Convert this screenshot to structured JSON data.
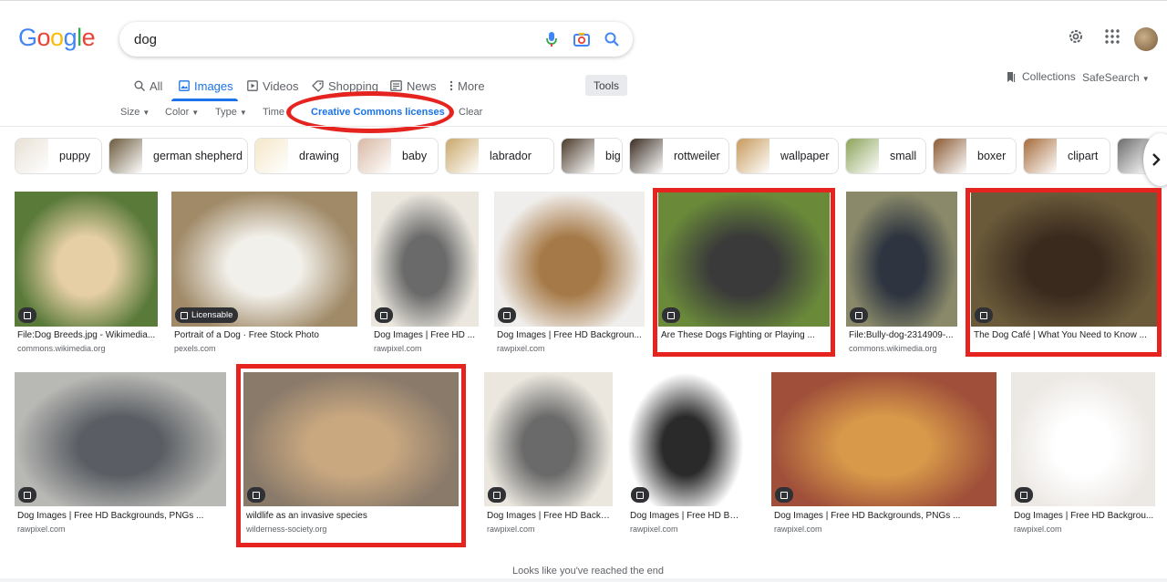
{
  "brand": {
    "letters": [
      {
        "ch": "G",
        "color": "#4285f4"
      },
      {
        "ch": "o",
        "color": "#ea4335"
      },
      {
        "ch": "o",
        "color": "#fbbc05"
      },
      {
        "ch": "g",
        "color": "#4285f4"
      },
      {
        "ch": "l",
        "color": "#34a853"
      },
      {
        "ch": "e",
        "color": "#ea4335"
      }
    ]
  },
  "search": {
    "value": "dog",
    "placeholder": ""
  },
  "header": {
    "settings_icon": "gear-icon",
    "apps_icon": "apps-grid-icon",
    "avatar_icon": "avatar"
  },
  "tabs": [
    {
      "label": "All",
      "icon": "search-icon",
      "active": false
    },
    {
      "label": "Images",
      "icon": "image-icon",
      "active": true
    },
    {
      "label": "Videos",
      "icon": "video-icon",
      "active": false
    },
    {
      "label": "Shopping",
      "icon": "tag-icon",
      "active": false
    },
    {
      "label": "News",
      "icon": "news-icon",
      "active": false
    },
    {
      "label": "More",
      "icon": "kebab-icon",
      "active": false
    }
  ],
  "tools_label": "Tools",
  "collections_label": "Collections",
  "safesearch_label": "SafeSearch",
  "filters": [
    {
      "label": "Size",
      "active": false
    },
    {
      "label": "Color",
      "active": false
    },
    {
      "label": "Type",
      "active": false
    },
    {
      "label": "Time",
      "active": false
    },
    {
      "label": "Creative Commons licenses",
      "active": true
    },
    {
      "label": "Clear",
      "active": false
    }
  ],
  "chips": [
    {
      "label": "puppy",
      "color": "#e8e0d4"
    },
    {
      "label": "german shepherd",
      "color": "#6b5a3c"
    },
    {
      "label": "drawing",
      "color": "#f5e7c8"
    },
    {
      "label": "baby",
      "color": "#d9b8a4"
    },
    {
      "label": "labrador",
      "color": "#c9a86a"
    },
    {
      "label": "big",
      "color": "#4a3a2a"
    },
    {
      "label": "rottweiler",
      "color": "#3a2d22"
    },
    {
      "label": "wallpaper",
      "color": "#c79a5c"
    },
    {
      "label": "small",
      "color": "#8ca35a"
    },
    {
      "label": "boxer",
      "color": "#8a5a32"
    },
    {
      "label": "clipart",
      "color": "#a66b3a"
    },
    {
      "label": "",
      "color": "#6c6c6c"
    }
  ],
  "results": [
    {
      "title": "File:Dog Breeds.jpg - Wikimedia...",
      "source": "commons.wikimedia.org",
      "licensable": false,
      "highlighted": false,
      "colors": [
        "#5a7a3a",
        "#e6cfa5"
      ]
    },
    {
      "title": "Portrait of a Dog · Free Stock Photo",
      "source": "pexels.com",
      "licensable": true,
      "highlighted": false,
      "colors": [
        "#a08a68",
        "#f2f0ea"
      ]
    },
    {
      "title": "Dog Images | Free HD ...",
      "source": "rawpixel.com",
      "licensable": false,
      "highlighted": false,
      "colors": [
        "#ebe7df",
        "#6a6a6a"
      ]
    },
    {
      "title": "Dog Images | Free HD Backgroun...",
      "source": "rawpixel.com",
      "licensable": false,
      "highlighted": false,
      "colors": [
        "#f0eeec",
        "#a67a48"
      ]
    },
    {
      "title": "Are These Dogs Fighting or Playing ...",
      "source": "",
      "licensable": false,
      "highlighted": true,
      "colors": [
        "#6a8a3a",
        "#3a3a3a"
      ]
    },
    {
      "title": "File:Bully-dog-2314909-...",
      "source": "commons.wikimedia.org",
      "licensable": false,
      "highlighted": false,
      "colors": [
        "#8a8a6a",
        "#2e3440"
      ]
    },
    {
      "title": "The Dog Café | What You Need to Know ...",
      "source": "",
      "licensable": false,
      "highlighted": true,
      "colors": [
        "#6a5a3a",
        "#3a2a1e"
      ]
    },
    {
      "title": "Dog Images | Free HD Backgrounds, PNGs ...",
      "source": "rawpixel.com",
      "licensable": false,
      "highlighted": false,
      "colors": [
        "#b8b8b4",
        "#5a5e64"
      ]
    },
    {
      "title": "wildlife as an invasive species",
      "source": "wilderness-society.org",
      "licensable": false,
      "highlighted": true,
      "colors": [
        "#8a7a6a",
        "#c9a880"
      ]
    },
    {
      "title": "Dog Images | Free HD Backg...",
      "source": "rawpixel.com",
      "licensable": false,
      "highlighted": false,
      "colors": [
        "#ebe7df",
        "#6a6a6a"
      ]
    },
    {
      "title": "Dog Images | Free HD Backg...",
      "source": "rawpixel.com",
      "licensable": false,
      "highlighted": false,
      "colors": [
        "#ffffff",
        "#2a2a2a"
      ]
    },
    {
      "title": "Dog Images | Free HD Backgrounds, PNGs ...",
      "source": "rawpixel.com",
      "licensable": false,
      "highlighted": false,
      "colors": [
        "#a0503a",
        "#d89a4a"
      ]
    },
    {
      "title": "Dog Images | Free HD Backgrou...",
      "source": "rawpixel.com",
      "licensable": false,
      "highlighted": false,
      "colors": [
        "#ece8e4",
        "#ffffff"
      ]
    }
  ],
  "badge_label": "Licensable",
  "end_text": "Looks like you've reached the end",
  "accent_color": "#1a73e8",
  "annotation_color": "#e5231f"
}
